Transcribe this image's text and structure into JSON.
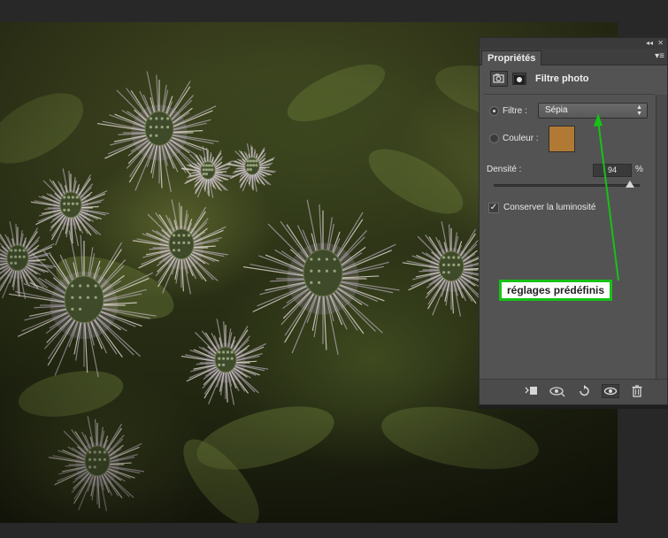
{
  "panel": {
    "tab_label": "Propriétés",
    "collapse_glyph": "◂◂",
    "close_glyph": "✕",
    "menu_glyph": "▾≡",
    "header_title": "Filtre photo",
    "header_icons": [
      "adjustment-layer-icon",
      "layer-mask-icon"
    ],
    "filter": {
      "label": "Filtre :",
      "value": "Sépia",
      "selected": true
    },
    "color": {
      "label": "Couleur :",
      "swatch_hex": "#b07a34",
      "selected": false
    },
    "density": {
      "label": "Densité :",
      "value": "94",
      "unit": "%",
      "slider_fraction": 0.94
    },
    "preserve_luminosity": {
      "label": "Conserver la luminosité",
      "checked": true,
      "check_glyph": "✓"
    },
    "footer_icons": [
      "clip-to-layer-icon",
      "view-previous-state-icon",
      "reset-icon",
      "visibility-eye-icon",
      "trash-icon"
    ],
    "footer_glyphs": [
      "⬚",
      "◉",
      "↺",
      "👁",
      "🗑"
    ]
  },
  "annotation": {
    "text": "réglages prédéfinis",
    "color": "#16c216"
  }
}
